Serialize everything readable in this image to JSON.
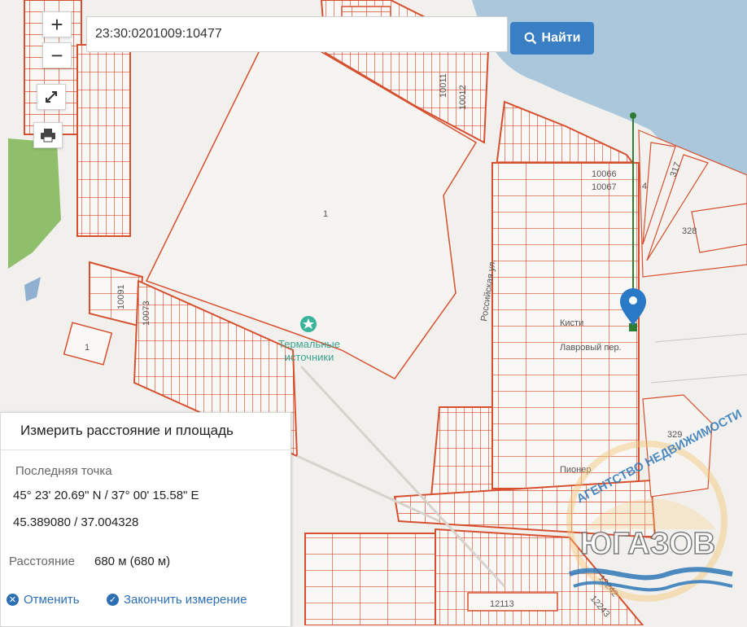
{
  "search": {
    "value": "23:30:0201009:10477",
    "button_label": "Найти",
    "button_icon": "search-icon"
  },
  "controls": {
    "zoom_in": "+",
    "zoom_out": "−",
    "fullscreen_icon": "expand-icon",
    "print_icon": "print-icon"
  },
  "map": {
    "plot_labels": [
      "10011",
      "10012",
      "1",
      "10091",
      "10073",
      "1",
      "10066",
      "10067",
      "4",
      "317",
      "328",
      "329",
      "12113",
      "12242",
      "12243"
    ],
    "poi_label_line1": "Термальные",
    "poi_label_line2": "источники",
    "street_label": "Российская ул.",
    "street_label_2": "Лавровый пер.",
    "street_label_3": "Кисти",
    "street_label_4": "Пионер",
    "colors": {
      "parcel": "#d6502f",
      "water": "#a9c7dd",
      "green": "#8fbf6a",
      "route": "#2e7d32",
      "marker": "#2979c7"
    }
  },
  "watermark": {
    "arc_text": "АГЕНТСТВО НЕДВИЖИМОСТИ",
    "brand": "ЮГАЗОВ"
  },
  "measure": {
    "title": "Измерить расстояние и площадь",
    "last_point_label": "Последняя точка",
    "coords_dms": "45° 23' 20.69\" N / 37° 00' 15.58\" E",
    "coords_dec": "45.389080 / 37.004328",
    "distance_label": "Расстояние",
    "distance_value": "680 м (680 м)",
    "cancel_label": "Отменить",
    "finish_label": "Закончить измерение"
  }
}
